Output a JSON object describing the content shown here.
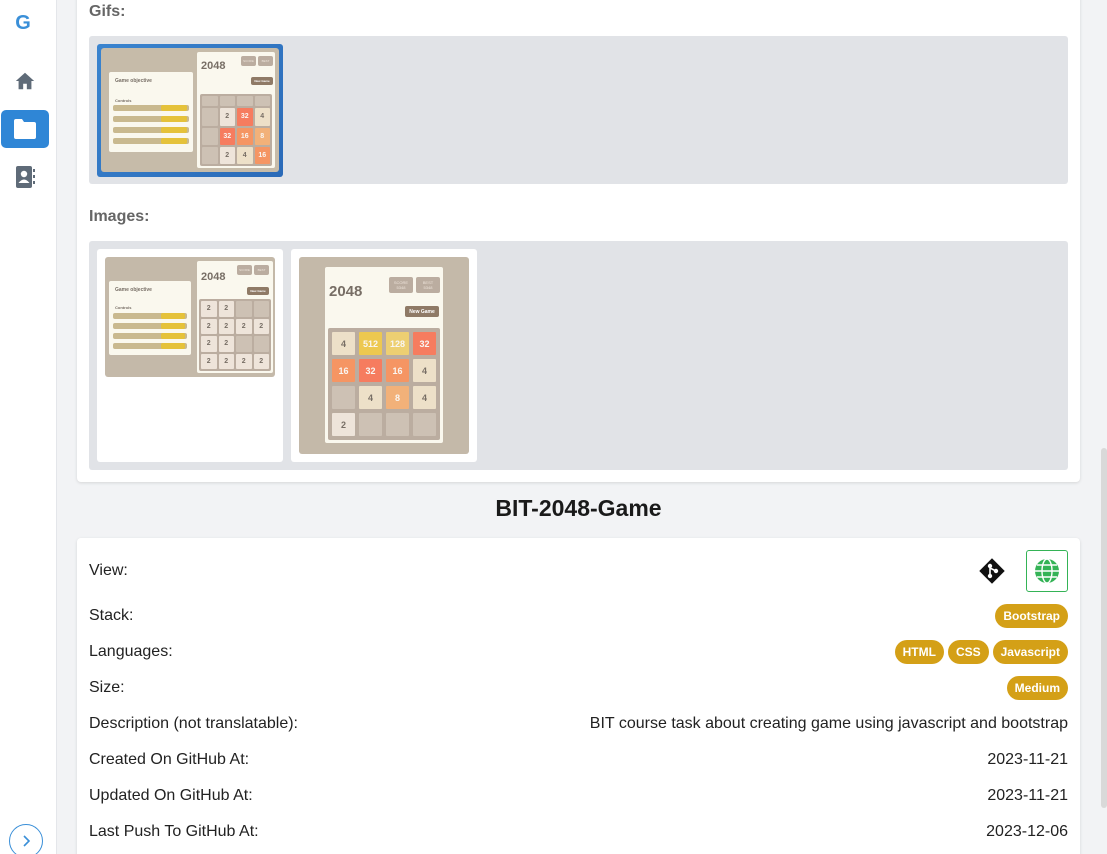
{
  "sidebar": {
    "logo": "G",
    "items": [
      {
        "icon": "home-icon",
        "active": false
      },
      {
        "icon": "folder-icon",
        "active": true
      },
      {
        "icon": "contact-book-icon",
        "active": false
      }
    ],
    "expand_icon": "chevron-right-icon"
  },
  "media": {
    "gifs_label": "Gifs:",
    "images_label": "Images:",
    "thumb_title": "2048",
    "thumb_objective": "Game objective",
    "thumb_controls": "Controls",
    "thumb_new_game": "New Game",
    "thumb_score": "SCORE",
    "thumb_best": "BEST",
    "gif_tiles": [
      "",
      "",
      "",
      "",
      "",
      "2",
      "32",
      "4",
      "",
      "32",
      "16",
      "8",
      "",
      "2",
      "4",
      "16"
    ],
    "image1_tiles": [
      "2",
      "2",
      "",
      "",
      "2",
      "2",
      "2",
      "2",
      "2",
      "2",
      "",
      "",
      "2",
      "2",
      "2",
      "2"
    ],
    "image2_tiles": [
      "4",
      "512",
      "128",
      "32",
      "16",
      "32",
      "16",
      "4",
      "",
      "4",
      "8",
      "4",
      "2",
      "",
      "",
      ""
    ],
    "image2_score": "5348",
    "image2_best": "5348"
  },
  "project": {
    "title": "BIT-2048-Game"
  },
  "details": {
    "view_label": "View:",
    "git_icon": "git-icon",
    "web_icon": "globe-icon",
    "stack_label": "Stack:",
    "stack": [
      "Bootstrap"
    ],
    "languages_label": "Languages:",
    "languages": [
      "HTML",
      "CSS",
      "Javascript"
    ],
    "size_label": "Size:",
    "size": "Medium",
    "description_label": "Description (not translatable):",
    "description": "BIT course task about creating game using javascript and bootstrap",
    "created_label": "Created On GitHub At:",
    "created": "2023-11-21",
    "updated_label": "Updated On GitHub At:",
    "updated": "2023-11-21",
    "pushed_label": "Last Push To GitHub At:",
    "pushed": "2023-12-06"
  },
  "colors": {
    "accent": "#2f86d6",
    "badge": "#d4a017",
    "web_green": "#34b356"
  }
}
